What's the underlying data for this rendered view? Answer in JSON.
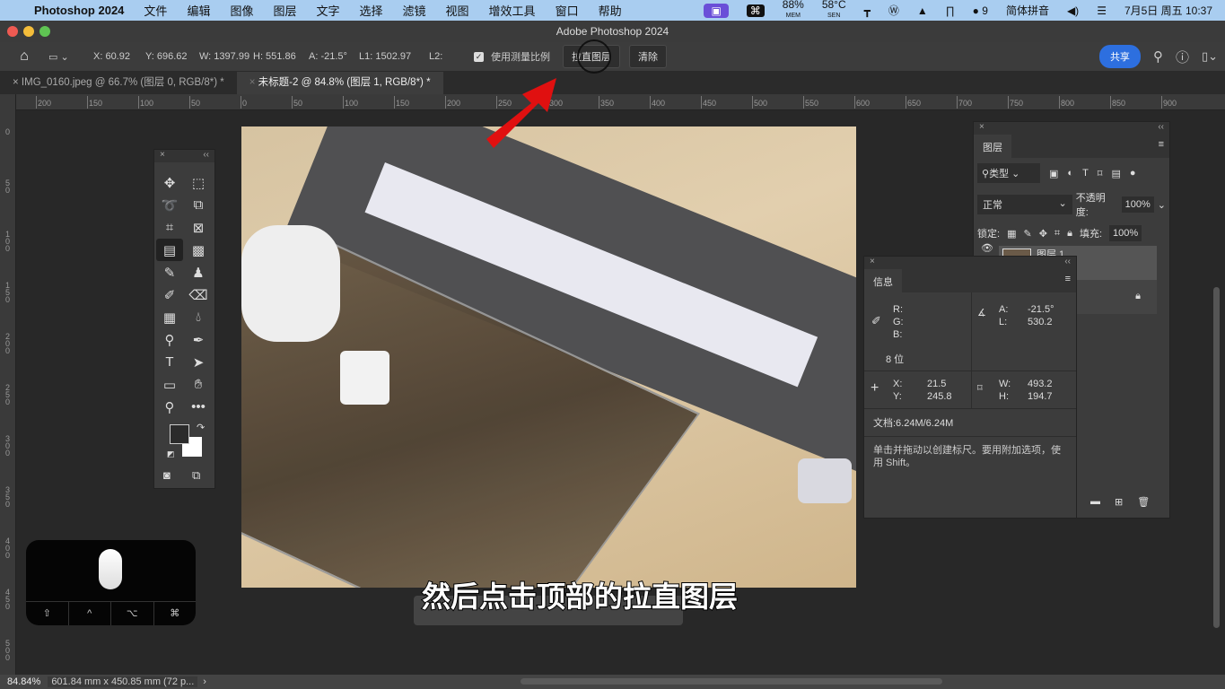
{
  "menubar": {
    "app": "Photoshop 2024",
    "items": [
      "文件",
      "编辑",
      "图像",
      "图层",
      "文字",
      "选择",
      "滤镜",
      "视图",
      "增效工具",
      "窗口",
      "帮助"
    ],
    "status": {
      "cpu": "88%",
      "cpu_sub": "MEM",
      "temp": "58°C",
      "temp_sub": "SEN",
      "wechat_count": "9",
      "input_method": "简体拼音",
      "datetime": "7月5日 周五 10:37"
    }
  },
  "window": {
    "title": "Adobe Photoshop 2024"
  },
  "options": {
    "x": "X: 60.92",
    "y": "Y: 696.62",
    "w": "W: 1397.99",
    "h": "H: 551.86",
    "a": "A: -21.5°",
    "l1": "L1: 1502.97",
    "l2": "L2:",
    "use_scale": "使用测量比例",
    "use_scale_checked": true,
    "straighten": "拉直图层",
    "clear": "清除",
    "share": "共享"
  },
  "tabs": [
    {
      "label": "IMG_0160.jpeg @ 66.7% (图层 0, RGB/8*) *",
      "active": false
    },
    {
      "label": "未标题-2 @ 84.8% (图层 1, RGB/8*) *",
      "active": true
    }
  ],
  "hruler": [
    "200",
    "150",
    "100",
    "50",
    "0",
    "50",
    "100",
    "150",
    "200",
    "250",
    "300",
    "350",
    "400",
    "450",
    "500",
    "550",
    "600",
    "650",
    "700",
    "750",
    "800",
    "850",
    "900"
  ],
  "vruler": [
    "0",
    "50",
    "100",
    "150",
    "200",
    "250",
    "300",
    "350",
    "400",
    "450",
    "500"
  ],
  "layers": {
    "tab": "图层",
    "filter": "类型",
    "blend": "正常",
    "opacity_label": "不透明度:",
    "opacity": "100%",
    "lock_label": "锁定:",
    "fill_label": "填充:",
    "fill": "100%",
    "layer_name": "图层 1"
  },
  "info": {
    "tab": "信息",
    "r": "R:",
    "g": "G:",
    "b": "B:",
    "bits": "8 位",
    "a_label": "A:",
    "a": "-21.5°",
    "l_label": "L:",
    "l": "530.2",
    "x_label": "X:",
    "x": "21.5",
    "y_label": "Y:",
    "y": "245.8",
    "w_label": "W:",
    "w": "493.2",
    "h_label": "H:",
    "h": "194.7",
    "doc": "文档:6.24M/6.24M",
    "hint": "单击并拖动以创建标尺。要用附加选项，使用 Shift。"
  },
  "keys": [
    "⇧",
    "^",
    "⌥",
    "⌘"
  ],
  "caption": "然后点击顶部的拉直图层",
  "status": {
    "zoom": "84.84%",
    "size": "601.84 mm x 450.85 mm (72 p...",
    "arrow": "›"
  },
  "colors": {
    "accent": "#2d6fdf",
    "arrow": "#e01010"
  }
}
